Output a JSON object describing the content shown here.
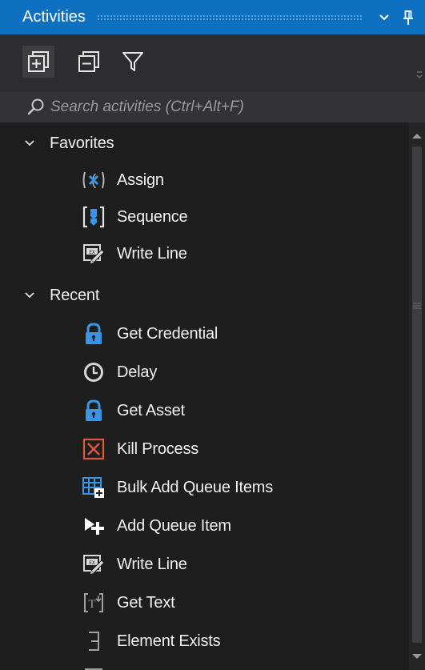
{
  "panel": {
    "title": "Activities"
  },
  "search": {
    "placeholder": "Search activities (Ctrl+Alt+F)"
  },
  "groups": [
    {
      "label": "Favorites",
      "items": [
        {
          "label": "Assign",
          "icon": "assign-icon"
        },
        {
          "label": "Sequence",
          "icon": "sequence-icon"
        },
        {
          "label": "Write Line",
          "icon": "write-line-icon"
        }
      ]
    },
    {
      "label": "Recent",
      "items": [
        {
          "label": "Get Credential",
          "icon": "lock-icon"
        },
        {
          "label": "Delay",
          "icon": "clock-icon"
        },
        {
          "label": "Get Asset",
          "icon": "lock-icon"
        },
        {
          "label": "Kill Process",
          "icon": "kill-process-icon"
        },
        {
          "label": "Bulk Add Queue Items",
          "icon": "bulk-add-queue-icon"
        },
        {
          "label": "Add Queue Item",
          "icon": "add-queue-icon"
        },
        {
          "label": "Write Line",
          "icon": "write-line-icon"
        },
        {
          "label": "Get Text",
          "icon": "get-text-icon"
        },
        {
          "label": "Element Exists",
          "icon": "element-exists-icon"
        }
      ]
    }
  ],
  "colors": {
    "accent": "#0e70c0",
    "background": "#1e1e1e",
    "toolbar": "#2d2d30",
    "search": "#333337"
  }
}
